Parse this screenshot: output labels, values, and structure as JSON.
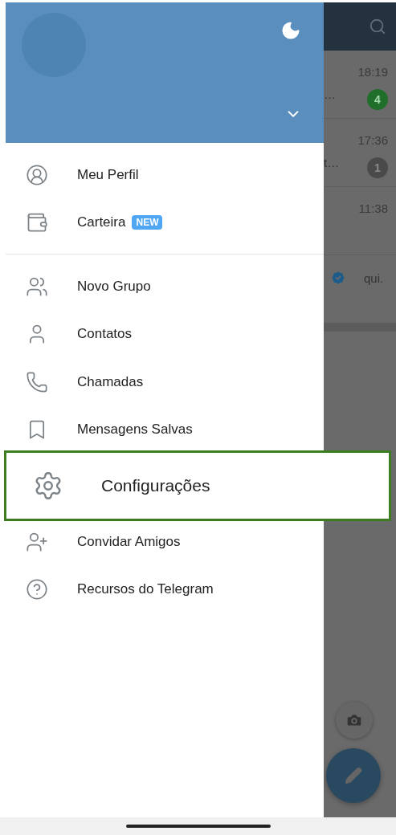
{
  "drawer": {
    "menu_sections": [
      [
        {
          "label": "Meu Perfil",
          "selected": false
        },
        {
          "label": "Carteira",
          "badge": "NEW",
          "selected": false
        }
      ],
      [
        {
          "label": "Novo Grupo",
          "selected": false
        },
        {
          "label": "Contatos",
          "selected": false
        },
        {
          "label": "Chamadas",
          "selected": false
        },
        {
          "label": "Mensagens Salvas",
          "selected": false
        },
        {
          "label": "Configurações",
          "selected": true
        },
        {
          "label": "Convidar Amigos",
          "selected": false
        },
        {
          "label": "Recursos do Telegram",
          "selected": false
        }
      ]
    ]
  },
  "chat_list": {
    "rows": [
      {
        "time": "18:19",
        "preview": "…",
        "unread": "4",
        "muted": false
      },
      {
        "time": "17:36",
        "preview": "t…",
        "unread": "1",
        "muted": true
      },
      {
        "time": "11:38"
      },
      {
        "verified": true,
        "preview": "qui."
      }
    ]
  }
}
